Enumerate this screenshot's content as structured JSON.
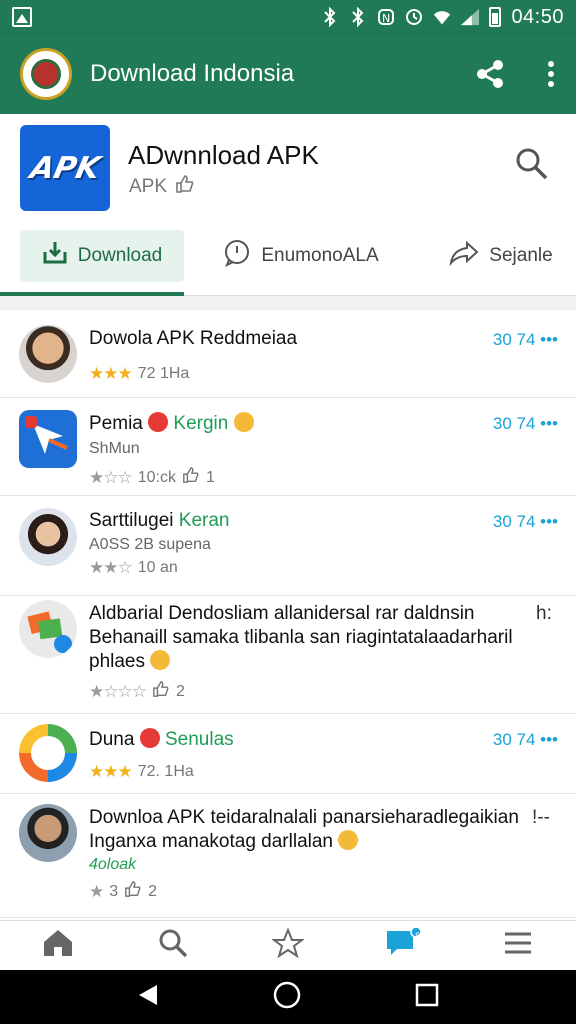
{
  "status_bar": {
    "time": "04:50",
    "icons": [
      "image-notification-icon",
      "bluetooth-icon",
      "bluetooth-icon",
      "nfc-icon",
      "alarm-icon",
      "wifi-icon",
      "signal-icon",
      "battery-icon"
    ]
  },
  "app_bar": {
    "title": "Download Indonsia",
    "share_icon": "share-icon",
    "menu_icon": "more-vert-icon"
  },
  "app_header": {
    "icon_text": "APK",
    "name": "ADwnnload APK",
    "subtitle": "APK",
    "tabs": [
      {
        "label": "Download",
        "icon": "download-icon",
        "active": true
      },
      {
        "label": "EnumonoALA",
        "icon": "comment-icon",
        "active": false
      },
      {
        "label": "Sejanle",
        "icon": "share-arrow-icon",
        "active": false
      }
    ]
  },
  "colors": {
    "primary": "#1f7a55",
    "accent_blue": "#1aa3d8",
    "star": "#f2b01e",
    "green_text": "#1f9d55"
  },
  "feed": [
    {
      "name": "Dowola APK Reddmeiaa",
      "meta": "72 1Ha",
      "stars": "★★★",
      "time": "30 74 •••"
    },
    {
      "name": "Pemia",
      "name_tag": "Kergin",
      "sub": "ShMun",
      "meta": "10:ck",
      "likes": "1",
      "stars": "★☆☆",
      "time": "30 74 •••"
    },
    {
      "name": "Sarttilugei",
      "name_tag": "Keran",
      "sub": "A0SS 2B supena",
      "meta": "10 an",
      "stars": "★★☆",
      "time": "30 74 •••"
    },
    {
      "line1": "Aldbarial Dendosliam allanidersal rar daldnsin",
      "line1_tail": "h:",
      "line2": "Behanaill samaka tlibanla san riagintatalaadarharil",
      "line3": "phlaes",
      "meta_stars": "★☆☆☆",
      "likes": "2"
    },
    {
      "name": "Duna",
      "name_tag": "Senulas",
      "meta": "72. 1Ha",
      "stars": "★★★",
      "time": "30 74 •••"
    },
    {
      "line1": "Downloa APK teidaralnalali panarsieharadlegaikian",
      "line1_tail": "!--",
      "line2": "Inganxa manakotag darllalan",
      "green_label": "4oloak",
      "meta": "3",
      "stars": "★",
      "likes": "2"
    }
  ],
  "bottom_nav": [
    "home-icon",
    "search-icon",
    "star-icon",
    "chat-icon",
    "menu-icon"
  ],
  "bottom_nav_badge": "8",
  "system_nav": [
    "back-icon",
    "home-circle-icon",
    "recents-icon"
  ]
}
